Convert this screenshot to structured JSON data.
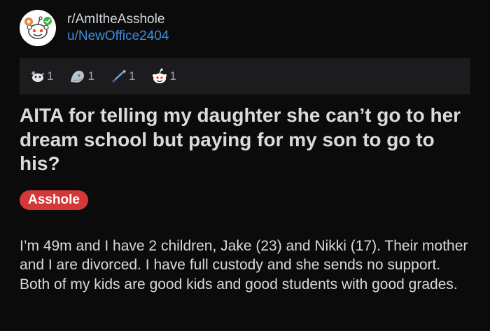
{
  "header": {
    "subreddit": "r/AmItheAsshole",
    "username": "u/NewOffice2404",
    "avatar_icon": "snoo-avatar-icon"
  },
  "awards": [
    {
      "icon": "wholesome-award-icon",
      "count": "1"
    },
    {
      "icon": "silver-award-icon",
      "count": "1"
    },
    {
      "icon": "helpful-award-icon",
      "count": "1"
    },
    {
      "icon": "snoo-award-icon",
      "count": "1"
    }
  ],
  "post": {
    "title": "AITA for telling my daughter she can’t go to her dream school but paying for my son to go to his?",
    "flair": "Asshole",
    "body": "I’m 49m and I have 2 children, Jake (23) and Nikki (17). Their mother and I are divorced. I have full custody and she sends no support. Both of my kids are good kids and good students with good grades."
  },
  "colors": {
    "background": "#0b0b0c",
    "username": "#3d8ddc",
    "flair_bg": "#d43737",
    "awards_bar": "#1c1c1e"
  }
}
